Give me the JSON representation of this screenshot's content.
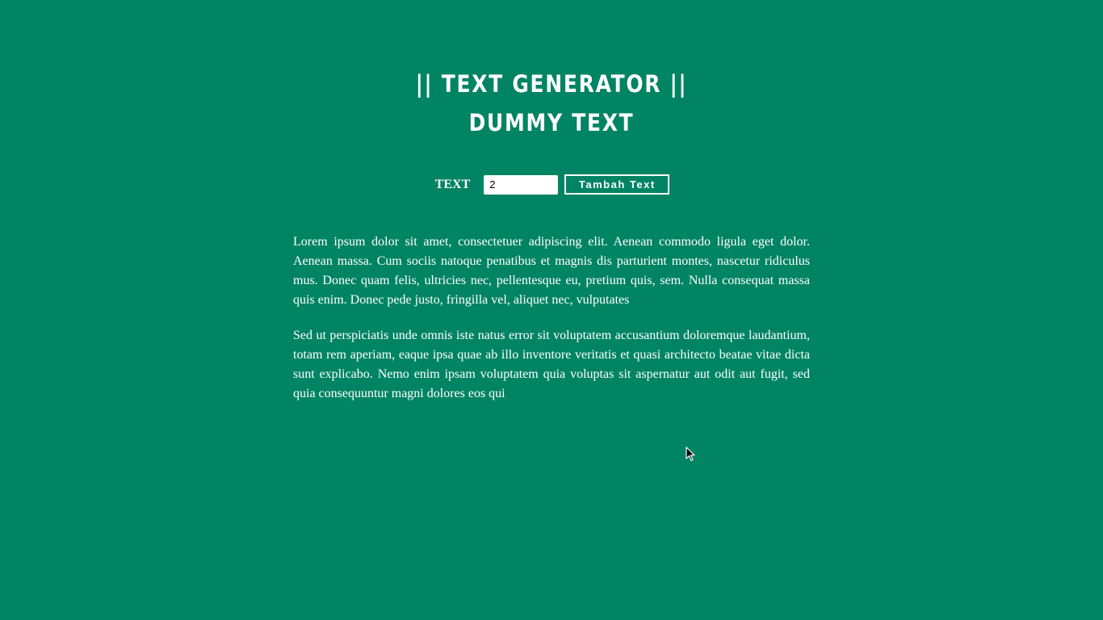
{
  "header": {
    "title_line1": "|| TEXT GENERATOR ||",
    "title_line2": "DUMMY TEXT"
  },
  "controls": {
    "label": "TEXT",
    "input_value": "2",
    "button_label": "Tambah Text"
  },
  "paragraphs": [
    "Lorem ipsum dolor sit amet, consectetuer adipiscing elit. Aenean commodo ligula eget dolor. Aenean massa. Cum sociis natoque penatibus et magnis dis parturient montes, nascetur ridiculus mus. Donec quam felis, ultricies nec, pellentesque eu, pretium quis, sem. Nulla consequat massa quis enim. Donec pede justo, fringilla vel, aliquet nec, vulputates",
    "Sed ut perspiciatis unde omnis iste natus error sit voluptatem accusantium doloremque laudantium, totam rem aperiam, eaque ipsa quae ab illo inventore veritatis et quasi architecto beatae vitae dicta sunt explicabo. Nemo enim ipsam voluptatem quia voluptas sit aspernatur aut odit aut fugit, sed quia consequuntur magni dolores eos qui"
  ],
  "colors": {
    "background": "#008463",
    "text": "#ffffff"
  },
  "icons": {
    "cursor": "mouse-pointer-icon"
  }
}
